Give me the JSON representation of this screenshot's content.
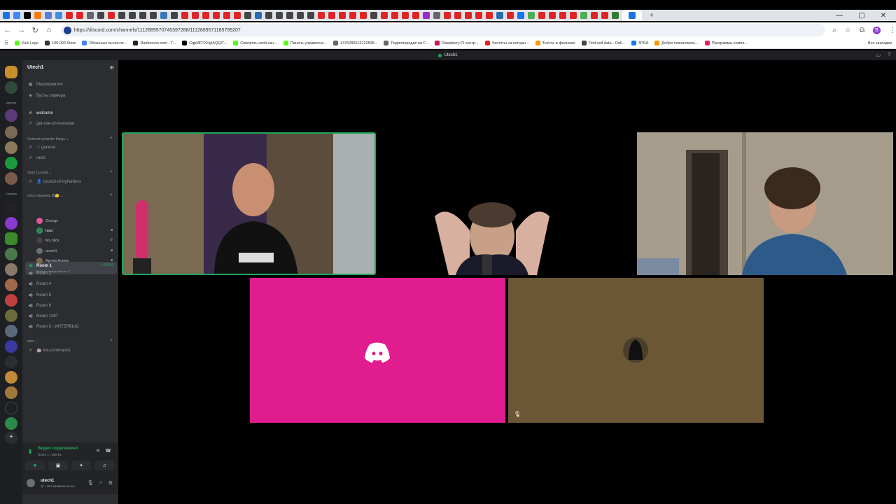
{
  "browser": {
    "url": "https://discord.com/channels/1112889570745397288/1112889571185799207",
    "tab_colors": [
      "#1a73e8",
      "#4285f4",
      "#000000",
      "#ff7a00",
      "#5a7fd6",
      "#3f8ee8",
      "#e02424",
      "#e02424",
      "#666666",
      "#444444",
      "#e02424",
      "#444444",
      "#444444",
      "#444444",
      "#444444",
      "#3b78b8",
      "#444444",
      "#e02424",
      "#e02424",
      "#e02424",
      "#e02424",
      "#e02424",
      "#e02424",
      "#444444",
      "#2b6cb0",
      "#444444",
      "#444444",
      "#444444",
      "#444444",
      "#444444",
      "#e02424",
      "#e02424",
      "#e02424",
      "#e02424",
      "#e02424",
      "#444444",
      "#e02424",
      "#e02424",
      "#e02424",
      "#e02424",
      "#9b2ac9",
      "#666666",
      "#e02424",
      "#e02424",
      "#e02424",
      "#e02424",
      "#e02424",
      "#2b6cb0",
      "#e02424",
      "#1a73e8",
      "#4caf50",
      "#e02424",
      "#e02424",
      "#e02424",
      "#e02424",
      "#4caf50",
      "#e02424",
      "#e02424",
      "#2e7d32",
      "#1a73e8"
    ],
    "bookmarks": [
      {
        "label": "Kick Logo",
        "color": "#53fc18"
      },
      {
        "label": "100,000 Stars",
        "color": "#333333"
      },
      {
        "label": "Облачные вычисле...",
        "color": "#4285f4"
      },
      {
        "label": "Radiooooo.com - T...",
        "color": "#222222"
      },
      {
        "label": "CqpMFFXXgIAQQiT...",
        "color": "#000000"
      },
      {
        "label": "Смотреть свой кан...",
        "color": "#53fc18"
      },
      {
        "label": "Панель управлени...",
        "color": "#53fc18"
      },
      {
        "label": "1476282613122595...",
        "color": "#666666"
      },
      {
        "label": "Радиопередатчик F...",
        "color": "#666666"
      },
      {
        "label": "Raspberry Pi настр...",
        "color": "#c51a4a"
      },
      {
        "label": "Частоты на которы...",
        "color": "#e02424"
      },
      {
        "label": "Тексты в фильмах",
        "color": "#ff9800"
      },
      {
        "label": "Find exif data - Onli...",
        "color": "#444444"
      },
      {
        "label": "4PDA",
        "color": "#1a73e8"
      },
      {
        "label": "Добро пожаловать...",
        "color": "#ff9800"
      },
      {
        "label": "Программы компа...",
        "color": "#e91e63"
      }
    ],
    "bookmarks_all": "Все закладки"
  },
  "window": {
    "title": "Utech1"
  },
  "server": {
    "name": "Utech1",
    "top_items": [
      {
        "icon": "calendar-icon",
        "label": "Мероприятия"
      },
      {
        "icon": "boost-icon",
        "label": "Бусты сервера"
      }
    ],
    "channels_top": [
      {
        "label": "welcome",
        "bright": true
      },
      {
        "label": "get-role-of-memeber",
        "bright": false
      }
    ],
    "cat1": "General tryharder things ⌄",
    "cat1_channels": [
      "☃ general",
      "raids"
    ],
    "cat2": "Valor Council ⌄",
    "cat2_channels": [
      "👤 council-of-tryharders"
    ],
    "cat3": "voice channels 😎🤔 ⌄",
    "active_room": "Room 1",
    "active_room_status": "Выбрать статус канала 🖉",
    "active_room_timer": "1:53:54",
    "members": [
      {
        "name": "George",
        "color": "#e0569b",
        "cam": ""
      },
      {
        "name": "Ivan",
        "color": "#3a7a5a",
        "cam": "▪"
      },
      {
        "name": "Mi_Nick",
        "color": "#444444",
        "cam": "🎙"
      },
      {
        "name": "utech1",
        "color": "#6b6f77",
        "cam": "▪"
      },
      {
        "name": "Артем Асеев",
        "color": "#7a6a4a",
        "cam": "▪"
      }
    ],
    "rooms": [
      "Room 2",
      "Room 4",
      "Room 5",
      "Room 6",
      "Room 1487",
      "Room 3 - ИНТЕРВЬЮ"
    ],
    "cat4": "misc ⌄",
    "cat4_channels": [
      "🤖 bot-commands"
    ]
  },
  "guild_labels": {
    "g1": "админы",
    "g2": "Зарядка"
  },
  "voice_panel": {
    "title": "Видео подключено",
    "subtitle": "Room 1 / Utech1"
  },
  "user": {
    "name": "utech1",
    "status": "Ⓜ • Нет времени на ра..."
  }
}
